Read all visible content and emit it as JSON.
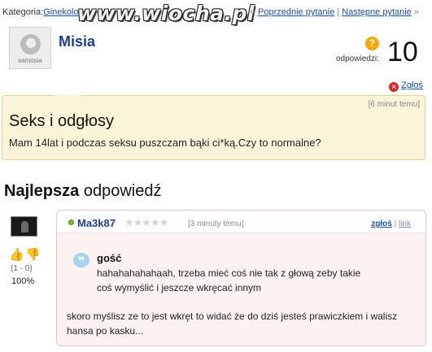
{
  "category": {
    "label": "Kategoria:",
    "value": "Ginekolog"
  },
  "nav": {
    "prev": "Poprzednie pytanie",
    "separator": "|",
    "next": "Następne pytanie",
    "prev_arrow": "«",
    "next_arrow": "»"
  },
  "watermark": "www.wiocha.pl",
  "asker": {
    "name": "Misia",
    "avatar_brand": "samosia"
  },
  "answers": {
    "label": "odpowiedzi:",
    "count": "10"
  },
  "report_label": "Zgłoś",
  "question": {
    "time": "[6 minut temu]",
    "title": "Seks i odgłosy",
    "body": "Mam 14lat i podczas seksu puszczam bąki ci*ką.Czy to normalne?"
  },
  "best_answer": {
    "heading_bold": "Najlepsza",
    "heading_rest": "odpowiedź",
    "votes": {
      "count": "(1 - 0)",
      "percent": "100%"
    },
    "user": "Ma3k87",
    "stars": "★★★★★",
    "time": "[3 minuty temu]",
    "report_link": "zgłoś",
    "link_sep": "|",
    "link": "link",
    "quote_author": "gość",
    "quote_text": "hahahahahahaah, trzeba mieć coś nie tak z głową zeby takie coś wymyślić i jeszcze wkręcać innym",
    "text": "skoro myślisz ze to jest wkręt to widać że do dziś jesteś prawiczkiem i walisz hansa po kasku..."
  },
  "colors": {
    "link": "#1d4fa0",
    "username": "#1d3f8f",
    "question_bg": "#fcf4d8",
    "answer_bg": "#fdf2f2",
    "report_icon": "#d9242c",
    "answers_icon": "#f5a800"
  }
}
